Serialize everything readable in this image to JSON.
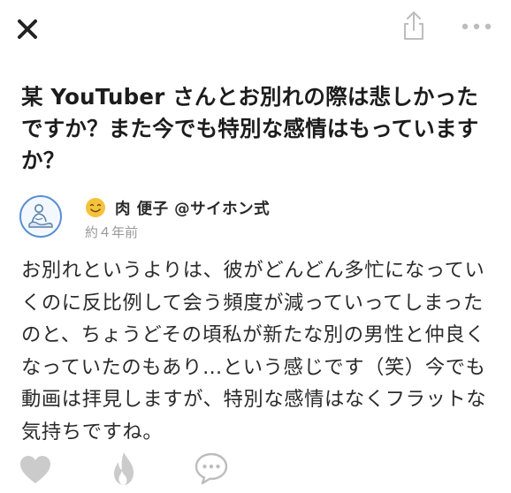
{
  "icons": {
    "close": "close-icon",
    "share": "share-icon",
    "more": "more-icon",
    "smiley": "smiley-icon",
    "like": "heart-icon",
    "fire": "fire-icon",
    "comment": "comment-icon"
  },
  "colors": {
    "avatar_border": "#5b8fd6",
    "icon_gray": "#c8c8c8",
    "smiley": "#f5c23a",
    "timestamp": "#9a9a9a"
  },
  "question": {
    "text": "某 YouTuber さんとお別れの際は悲しかったですか？また今でも特別な感情はもっていますか？"
  },
  "author": {
    "name": "肉 便子 @サイホン式",
    "timestamp": "約４年前"
  },
  "answer": {
    "text": "お別れというよりは、彼がどんどん多忙になっていくのに反比例して会う頻度が減っていってしまったのと、ちょうどその頃私が新たな別の男性と仲良くなっていたのもあり…という感じです（笑）今でも動画は拝見しますが、特別な感情はなくフラットな気持ちですね。"
  }
}
